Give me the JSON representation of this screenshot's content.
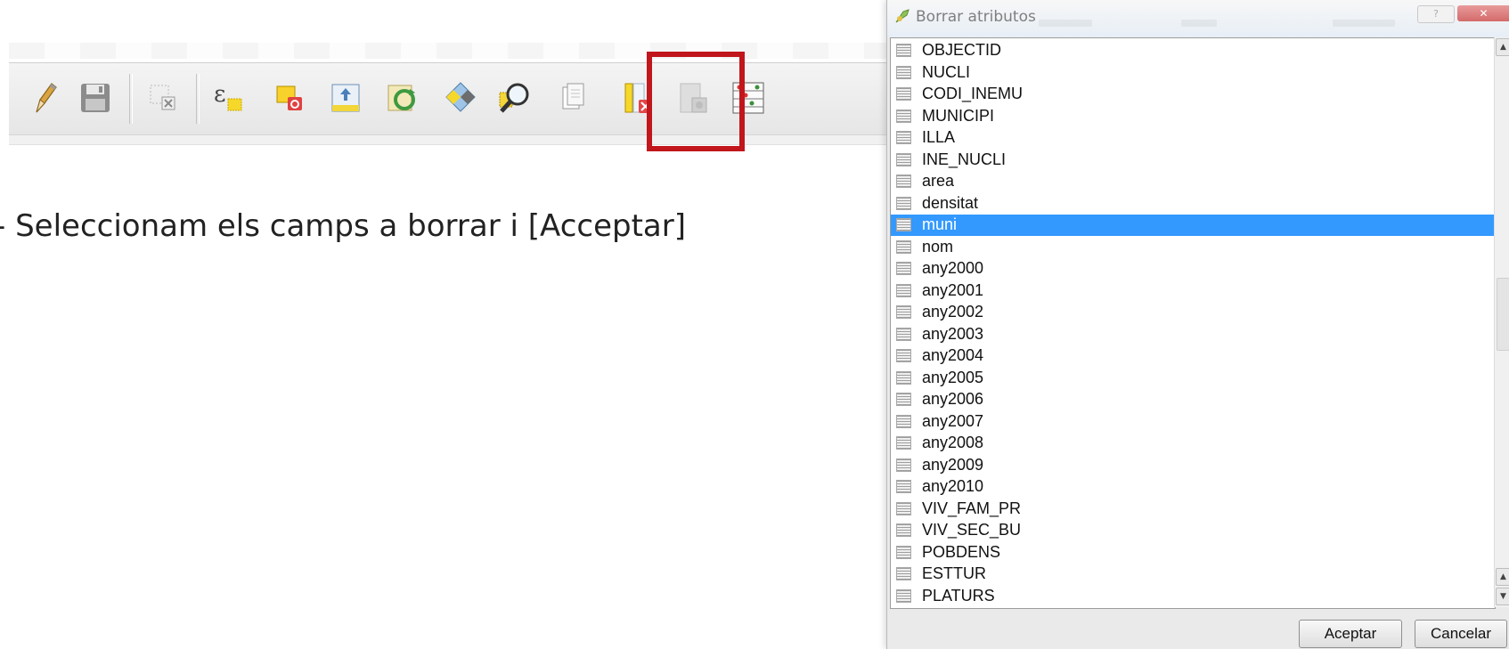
{
  "caption": "- Seleccionam els camps a borrar i [Acceptar]",
  "toolbar": {
    "icons": [
      "pencil-edit-icon",
      "save-edits-icon",
      "delete-selected-icon",
      "expression-select-icon",
      "edit-feature-icon",
      "attribute-table-icon",
      "refresh-layer-icon",
      "select-features-icon",
      "identify-zoom-icon",
      "copy-icon",
      "delete-column-icon",
      "save-column-icon",
      "field-calculator-icon"
    ],
    "highlighted_icon": "delete-column-icon",
    "highlight_color": "#c0161c"
  },
  "dialog": {
    "title": "Borrar atributos",
    "fields": [
      "OBJECTID",
      "NUCLI",
      "CODI_INEMU",
      "MUNICIPI",
      "ILLA",
      "INE_NUCLI",
      "area",
      "densitat",
      "muni",
      "nom",
      "any2000",
      "any2001",
      "any2002",
      "any2003",
      "any2004",
      "any2005",
      "any2006",
      "any2007",
      "any2008",
      "any2009",
      "any2010",
      "VIV_FAM_PR",
      "VIV_SEC_BU",
      "POBDENS",
      "ESTTUR",
      "PLATURS"
    ],
    "selected_field": "muni",
    "selection_color": "#3399ff",
    "accept_label": "Aceptar",
    "cancel_label": "Cancelar"
  }
}
